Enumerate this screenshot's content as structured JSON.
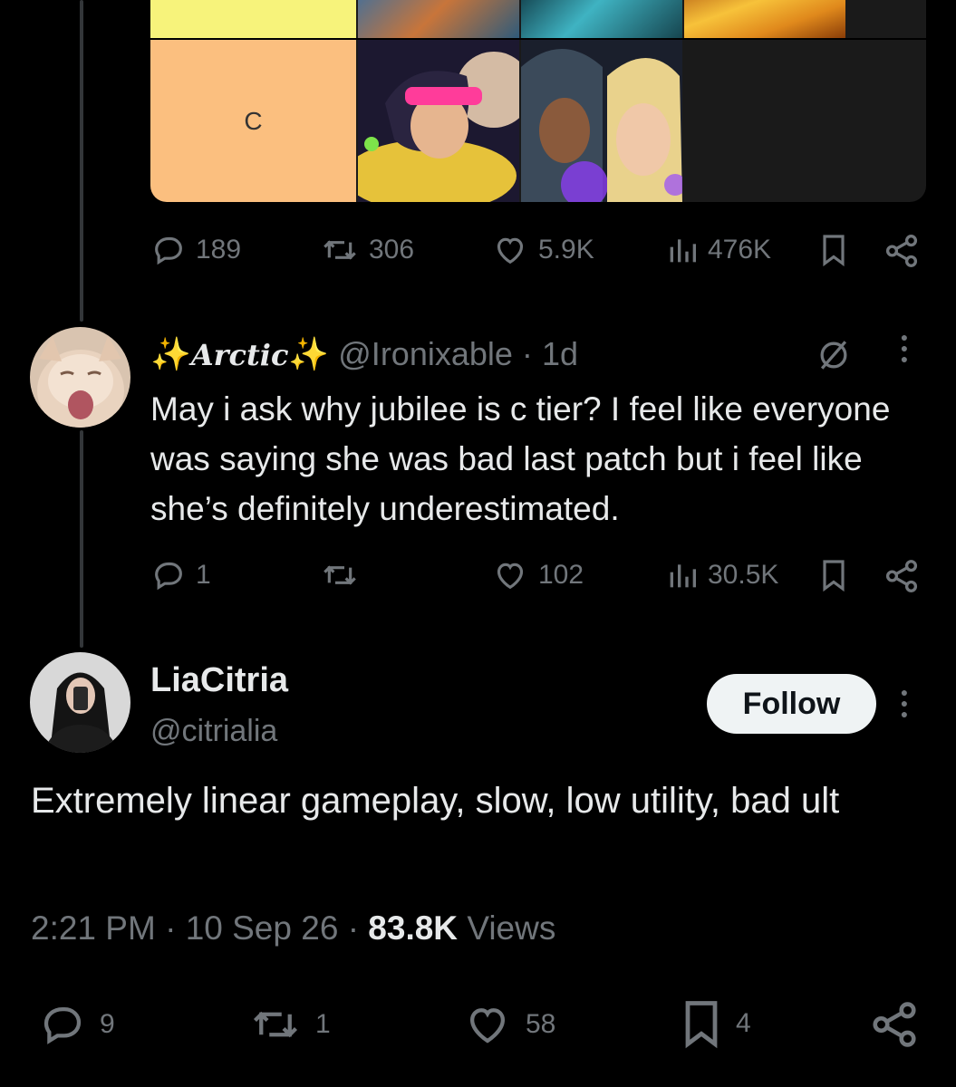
{
  "tier_list": {
    "rows": [
      {
        "label": "",
        "color": "#f7f37b"
      },
      {
        "label": "C",
        "color": "#fbbf7f"
      }
    ]
  },
  "top_post_actions": {
    "replies": "189",
    "reposts": "306",
    "likes": "5.9K",
    "views": "476K"
  },
  "reply": {
    "display_name": "Arctic",
    "handle": "@Ironixable",
    "time": "1d",
    "text": "May i ask why jubilee is c tier? I feel like everyone was saying she was bad last patch but i feel like she’s definitely underestimated.",
    "actions": {
      "replies": "1",
      "reposts": "",
      "likes": "102",
      "views": "30.5K"
    }
  },
  "main_post": {
    "display_name": "LiaCitria",
    "handle": "@citrialia",
    "follow_label": "Follow",
    "text": "Extremely linear gameplay, slow, low utility, bad ult",
    "time": "2:21 PM",
    "date": "10 Sep 26",
    "views_count": "83.8K",
    "views_label": "Views",
    "actions": {
      "replies": "9",
      "reposts": "1",
      "likes": "58",
      "bookmarks": "4"
    }
  },
  "colors": {
    "background": "#000000",
    "text_primary": "#e7e9ea",
    "text_secondary": "#71767b",
    "button_bg": "#eff3f4"
  }
}
